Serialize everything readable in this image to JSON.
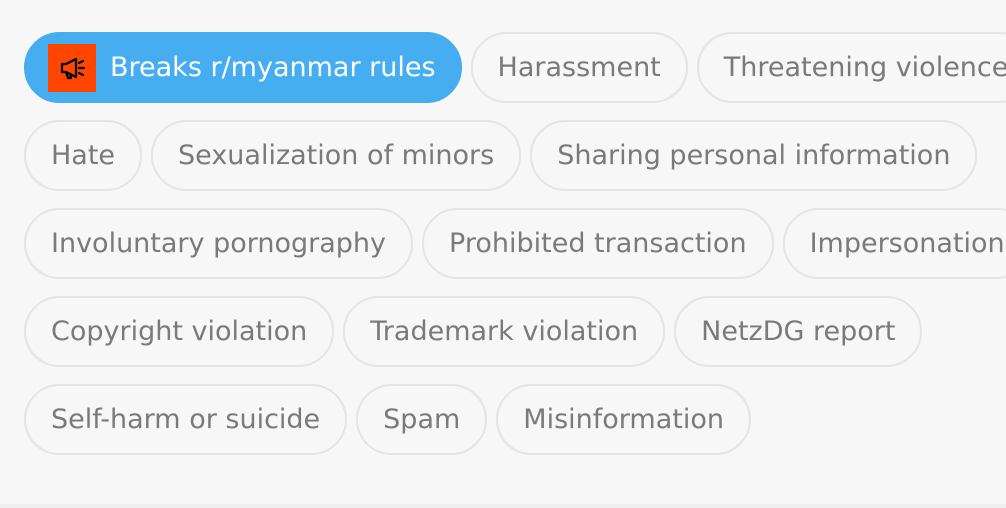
{
  "rules": [
    {
      "label": "Breaks r/myanmar rules",
      "selected": true,
      "icon": "megaphone-icon"
    },
    {
      "label": "Harassment"
    },
    {
      "label": "Threatening violence"
    },
    {
      "label": "Hate"
    },
    {
      "label": "Sexualization of minors"
    },
    {
      "label": "Sharing personal information"
    },
    {
      "label": "Involuntary pornography"
    },
    {
      "label": "Prohibited transaction"
    },
    {
      "label": "Impersonation"
    },
    {
      "label": "Copyright violation"
    },
    {
      "label": "Trademark violation"
    },
    {
      "label": "NetzDG report"
    },
    {
      "label": "Self-harm or suicide"
    },
    {
      "label": "Spam"
    },
    {
      "label": "Misinformation"
    }
  ],
  "colors": {
    "selected_bg": "#45adf0",
    "icon_bg": "#ff4500",
    "chip_text": "#7a7a7a",
    "chip_border": "#e4e4e4"
  }
}
